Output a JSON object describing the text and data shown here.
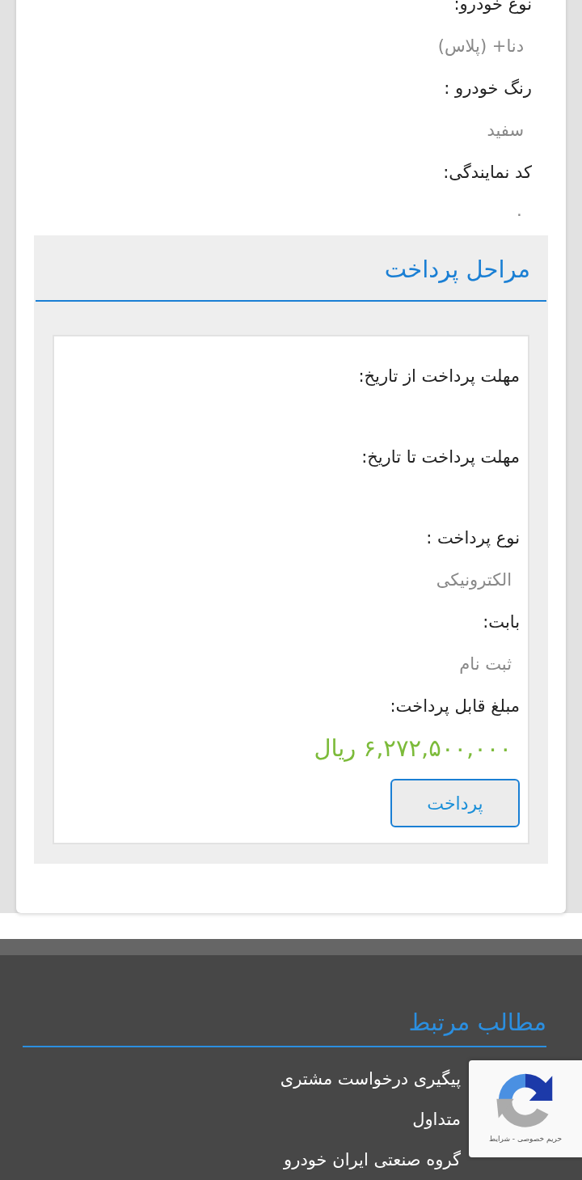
{
  "car_fields": [
    {
      "label": "نوع خودرو:",
      "value": "دنا+ (پلاس)"
    },
    {
      "label": "رنگ خودرو :",
      "value": "سفید"
    },
    {
      "label": "کد نمایندگی:",
      "value": "۰"
    }
  ],
  "payment": {
    "title": "مراحل پرداخت",
    "fields": [
      {
        "label": "مهلت پرداخت از تاریخ:"
      },
      {
        "label": "مهلت پرداخت تا تاریخ:"
      },
      {
        "label": "نوع پرداخت :",
        "value": "الکترونیکی"
      },
      {
        "label": "بابت:",
        "value": "ثبت نام"
      },
      {
        "label": "مبلغ قابل پرداخت:"
      }
    ],
    "amount": "۶,۲۷۲,۵۰۰,۰۰۰ ریال",
    "button": "پرداخت"
  },
  "footer": {
    "title": "مطالب مرتبط",
    "links": [
      "پیگیری درخواست مشتری",
      "متداول",
      "گروه صنعتی ایران خودرو"
    ]
  },
  "recaptcha": {
    "text": "حریم خصوصی - شرایط"
  }
}
